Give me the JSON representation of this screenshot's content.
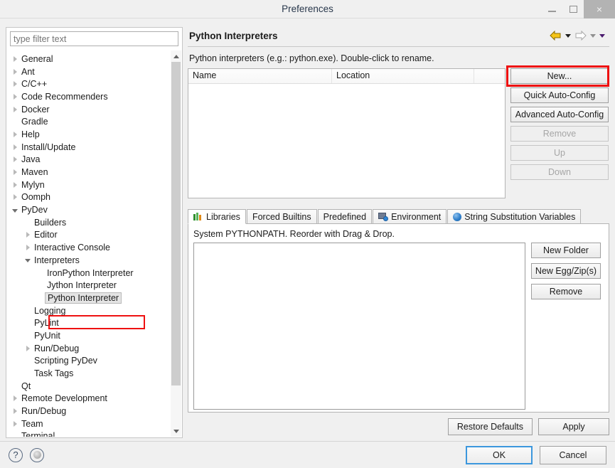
{
  "window": {
    "title": "Preferences",
    "minimize_label": "–",
    "maximize_label": "□",
    "close_label": "×"
  },
  "sidebar": {
    "filter_placeholder": "type filter text",
    "items": [
      {
        "label": "General",
        "indent": 0,
        "state": "collapsed"
      },
      {
        "label": "Ant",
        "indent": 0,
        "state": "collapsed"
      },
      {
        "label": "C/C++",
        "indent": 0,
        "state": "collapsed"
      },
      {
        "label": "Code Recommenders",
        "indent": 0,
        "state": "collapsed"
      },
      {
        "label": "Docker",
        "indent": 0,
        "state": "collapsed"
      },
      {
        "label": "Gradle",
        "indent": 0,
        "state": "leaf"
      },
      {
        "label": "Help",
        "indent": 0,
        "state": "collapsed"
      },
      {
        "label": "Install/Update",
        "indent": 0,
        "state": "collapsed"
      },
      {
        "label": "Java",
        "indent": 0,
        "state": "collapsed"
      },
      {
        "label": "Maven",
        "indent": 0,
        "state": "collapsed"
      },
      {
        "label": "Mylyn",
        "indent": 0,
        "state": "collapsed"
      },
      {
        "label": "Oomph",
        "indent": 0,
        "state": "collapsed"
      },
      {
        "label": "PyDev",
        "indent": 0,
        "state": "expanded"
      },
      {
        "label": "Builders",
        "indent": 1,
        "state": "leaf"
      },
      {
        "label": "Editor",
        "indent": 1,
        "state": "collapsed"
      },
      {
        "label": "Interactive Console",
        "indent": 1,
        "state": "collapsed"
      },
      {
        "label": "Interpreters",
        "indent": 1,
        "state": "expanded"
      },
      {
        "label": "IronPython Interpreter",
        "indent": 2,
        "state": "leaf"
      },
      {
        "label": "Jython Interpreter",
        "indent": 2,
        "state": "leaf"
      },
      {
        "label": "Python Interpreter",
        "indent": 2,
        "state": "leaf",
        "selected": true,
        "highlighted": true
      },
      {
        "label": "Logging",
        "indent": 1,
        "state": "leaf"
      },
      {
        "label": "PyLint",
        "indent": 1,
        "state": "leaf"
      },
      {
        "label": "PyUnit",
        "indent": 1,
        "state": "leaf"
      },
      {
        "label": "Run/Debug",
        "indent": 1,
        "state": "collapsed"
      },
      {
        "label": "Scripting PyDev",
        "indent": 1,
        "state": "leaf"
      },
      {
        "label": "Task Tags",
        "indent": 1,
        "state": "leaf"
      },
      {
        "label": "Qt",
        "indent": 0,
        "state": "leaf"
      },
      {
        "label": "Remote Development",
        "indent": 0,
        "state": "collapsed"
      },
      {
        "label": "Run/Debug",
        "indent": 0,
        "state": "collapsed"
      },
      {
        "label": "Team",
        "indent": 0,
        "state": "collapsed"
      },
      {
        "label": "Terminal",
        "indent": 0,
        "state": "leaf"
      }
    ]
  },
  "page": {
    "title": "Python Interpreters",
    "description": "Python interpreters (e.g.: python.exe).   Double-click to rename.",
    "nav": {
      "back_icon": "back-arrow-icon",
      "forward_icon": "forward-arrow-icon",
      "menu_icon": "dropdown-caret-icon"
    }
  },
  "interpreter_table": {
    "columns": [
      "Name",
      "Location",
      ""
    ],
    "rows": []
  },
  "interpreter_buttons": [
    {
      "label": "New...",
      "enabled": true,
      "highlighted": true
    },
    {
      "label": "Quick Auto-Config",
      "enabled": true
    },
    {
      "label": "Advanced Auto-Config",
      "enabled": true
    },
    {
      "label": "Remove",
      "enabled": false
    },
    {
      "label": "Up",
      "enabled": false
    },
    {
      "label": "Down",
      "enabled": false
    }
  ],
  "tabs": [
    {
      "label": "Libraries",
      "icon": "books-icon",
      "active": true
    },
    {
      "label": "Forced Builtins",
      "icon": "",
      "active": false
    },
    {
      "label": "Predefined",
      "icon": "",
      "active": false
    },
    {
      "label": "Environment",
      "icon": "environment-icon",
      "active": false
    },
    {
      "label": "String Substitution Variables",
      "icon": "blue-ball-icon",
      "active": false
    }
  ],
  "libraries_panel": {
    "label": "System PYTHONPATH.   Reorder with Drag & Drop.",
    "entries": [],
    "buttons": [
      {
        "label": "New Folder"
      },
      {
        "label": "New Egg/Zip(s)"
      },
      {
        "label": "Remove"
      }
    ]
  },
  "page_actions": [
    {
      "label": "Restore Defaults"
    },
    {
      "label": "Apply"
    }
  ],
  "footer": {
    "help_icon": "question-mark-icon",
    "secondary_icon": "circle-button-icon",
    "buttons": [
      {
        "label": "OK",
        "primary": true
      },
      {
        "label": "Cancel",
        "primary": false
      }
    ]
  },
  "colors": {
    "annotation": "#ee1111",
    "focus": "#3c97dd",
    "window_bg": "#f0f0f0"
  }
}
